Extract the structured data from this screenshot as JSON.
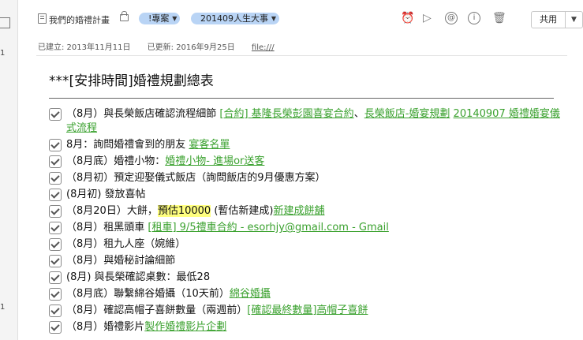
{
  "sidebar": {
    "numbers": [
      "1",
      "1"
    ]
  },
  "header": {
    "notebook": "我們的婚禮計畫",
    "tags": [
      {
        "label": "!專案"
      },
      {
        "label": "201409人生大事"
      }
    ],
    "share_label": "共用"
  },
  "meta": {
    "created": "已建立: 2013年11月11日",
    "updated": "已更新: 2016年9月25日",
    "source": "file:///"
  },
  "note": {
    "title": "***[安排時間]婚禮規劃總表",
    "items": [
      {
        "parts": [
          {
            "t": "（8月）與長榮飯店確認流程細節 "
          },
          {
            "t": "[合約] 基隆長榮彭園喜宴合約",
            "link": true
          },
          {
            "t": "、"
          },
          {
            "t": "長榮飯店-婚宴規劃",
            "link": true
          },
          {
            "t": " "
          },
          {
            "t": "20140907 婚禮婚宴儀式流程",
            "link": true
          }
        ]
      },
      {
        "parts": [
          {
            "t": "8月：詢問婚禮會到的朋友 "
          },
          {
            "t": "宴客名單",
            "link": true
          }
        ]
      },
      {
        "parts": [
          {
            "t": "（8月底）婚禮小物："
          },
          {
            "t": "婚禮小物- 進場or送客",
            "link": true
          }
        ]
      },
      {
        "parts": [
          {
            "t": "（8月初）預定迎娶儀式飯店（詢問飯店的9月優惠方案）"
          }
        ]
      },
      {
        "parts": [
          {
            "t": "(8月初) 發放喜帖"
          }
        ]
      },
      {
        "parts": [
          {
            "t": "（8月20日）大餅，"
          },
          {
            "t": "預估10000",
            "hl": true
          },
          {
            "t": " (暫估新建成)"
          },
          {
            "t": "新建成餅舖",
            "link": true
          }
        ]
      },
      {
        "parts": [
          {
            "t": "（8月）租黑頭車 "
          },
          {
            "t": "[租車] 9/5禮車合約 - esorhjy@gmail.com - Gmail",
            "link": true
          }
        ]
      },
      {
        "parts": [
          {
            "t": "（8月）租九人座（婉維）"
          }
        ]
      },
      {
        "parts": [
          {
            "t": "（8月）與婚秘討論細節"
          }
        ]
      },
      {
        "parts": [
          {
            "t": "(8月) 與長榮確認桌數：最低28"
          }
        ]
      },
      {
        "parts": [
          {
            "t": "（8月底）聯繫綿谷婚攝（10天前）"
          },
          {
            "t": "綿谷婚攝",
            "link": true
          }
        ]
      },
      {
        "parts": [
          {
            "t": "（8月）確認高帽子喜餅數量（兩週前）"
          },
          {
            "t": "[確認最終數量]高帽子喜餅",
            "link": true
          }
        ]
      },
      {
        "parts": [
          {
            "t": "（8月）婚禮影片"
          },
          {
            "t": "製作婚禮影片企劃",
            "link": true
          }
        ]
      }
    ]
  },
  "icons": [
    "notebook-icon",
    "lock-icon",
    "reminder-icon",
    "present-icon",
    "at-icon",
    "info-icon",
    "trash-icon",
    "checkbox-icon"
  ],
  "colors": {
    "link": "#3aa12e",
    "tag_bg": "#b9d4f5",
    "highlight": "#ffff80"
  }
}
